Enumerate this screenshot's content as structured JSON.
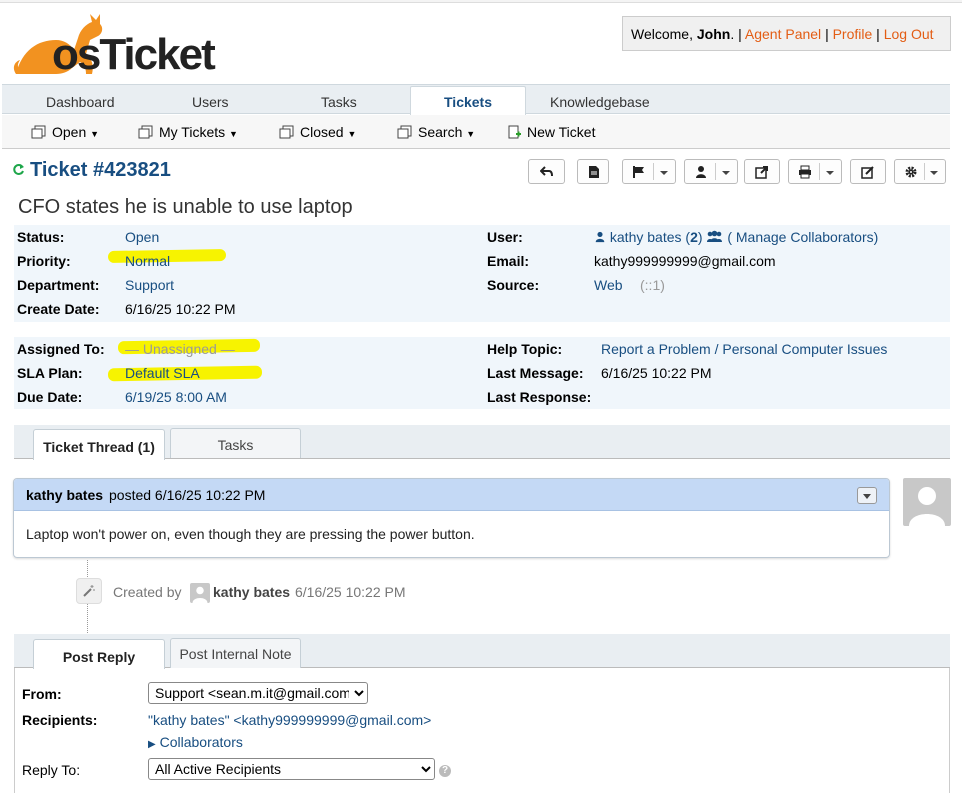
{
  "header": {
    "logo_text": "osTicket",
    "welcome_prefix": "Welcome, ",
    "user_name": "John",
    "welcome_suffix": ". |",
    "agent_panel": "Agent Panel",
    "sep1": "|",
    "profile": "Profile",
    "sep2": "|",
    "logout": "Log Out"
  },
  "nav": {
    "tabs": [
      "Dashboard",
      "Users",
      "Tasks",
      "Tickets",
      "Knowledgebase"
    ],
    "active": "Tickets"
  },
  "subnav": {
    "open": "Open",
    "my_tickets": "My Tickets",
    "closed": "Closed",
    "search": "Search",
    "new_ticket": "New Ticket"
  },
  "ticket": {
    "number": "Ticket #423821",
    "subject": "CFO states he is unable to use laptop",
    "status_label": "Status:",
    "status": "Open",
    "priority_label": "Priority:",
    "priority": "Normal",
    "department_label": "Department:",
    "department": "Support",
    "create_date_label": "Create Date:",
    "create_date": "6/16/25 10:22 PM",
    "user_label": "User:",
    "user_name": "kathy bates",
    "user_count_open": "(",
    "user_count": "2",
    "user_count_close": ")",
    "manage_collaborators": "( Manage Collaborators)",
    "email_label": "Email:",
    "email": "kathy999999999@gmail.com",
    "source_label": "Source:",
    "source": "Web",
    "source_ip": "(::1)",
    "assigned_label": "Assigned To:",
    "assigned": "— Unassigned —",
    "sla_label": "SLA Plan:",
    "sla": "Default SLA",
    "due_label": "Due Date:",
    "due": "6/19/25 8:00 AM",
    "help_topic_label": "Help Topic:",
    "help_topic": "Report a Problem / Personal Computer Issues",
    "last_message_label": "Last Message:",
    "last_message": "6/16/25 10:22 PM",
    "last_response_label": "Last Response:",
    "last_response": ""
  },
  "thread": {
    "tab_thread": "Ticket Thread (1)",
    "tab_tasks": "Tasks",
    "entry_author": "kathy bates",
    "entry_posted": "posted 6/16/25 10:22 PM",
    "entry_body": "Laptop won't power on, even though they are pressing the power button.",
    "event_created_by": "Created by",
    "event_author": "kathy bates",
    "event_date": "6/16/25 10:22 PM"
  },
  "reply": {
    "tab_post_reply": "Post Reply",
    "tab_internal_note": "Post Internal Note",
    "from_label": "From:",
    "from_value": "Support <sean.m.it@gmail.com>",
    "recipients_label": "Recipients:",
    "recipients_value": "\"kathy bates\" <kathy999999999@gmail.com>",
    "collaborators": "Collaborators",
    "reply_to_label": "Reply To:",
    "reply_to_value": "All Active Recipients",
    "help": "?"
  },
  "colors": {
    "link": "#184e81",
    "header_link": "#e35d14",
    "highlight": "#f7f300",
    "entry_header": "#c4d9f5",
    "refresh": "#1ea64a"
  }
}
